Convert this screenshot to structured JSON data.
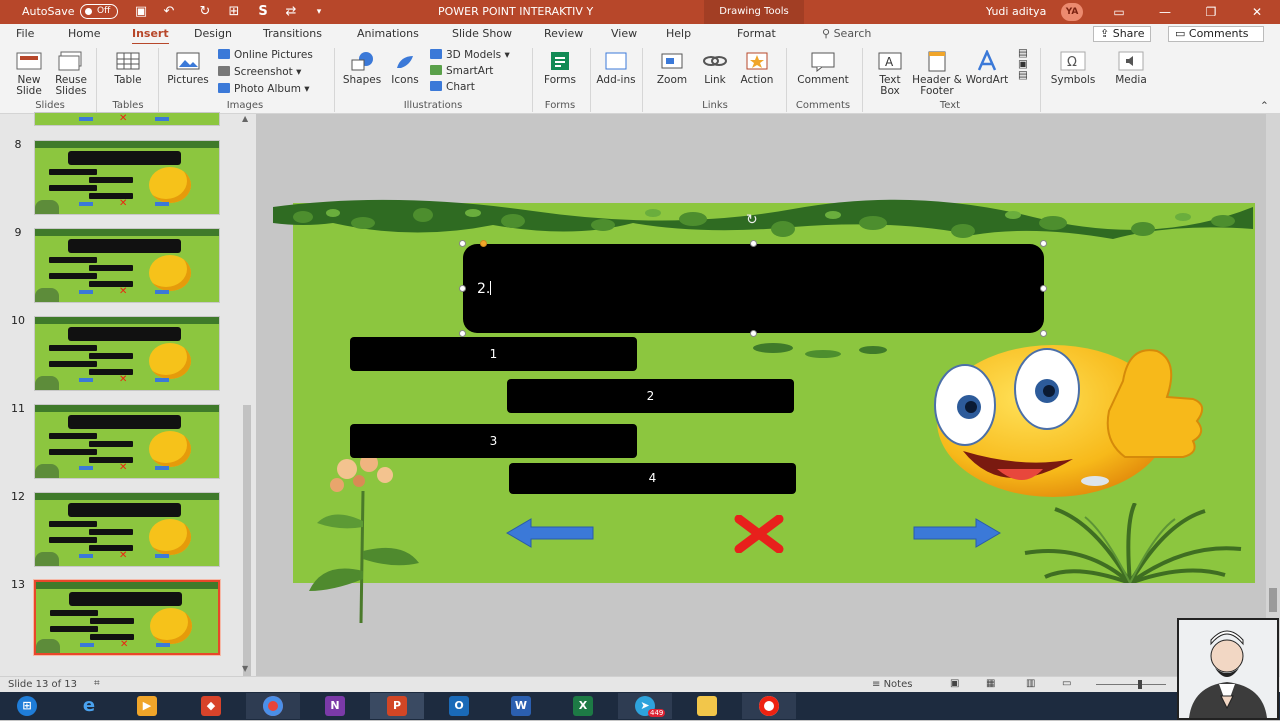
{
  "titlebar": {
    "autosave_label": "AutoSave",
    "autosave_state": "Off",
    "document_title": "POWER POINT INTERAKTIV Y",
    "contextual_tab_group": "Drawing Tools",
    "user_name": "Yudi aditya",
    "user_initials": "YA"
  },
  "tabs": [
    "File",
    "Home",
    "Insert",
    "Design",
    "Transitions",
    "Animations",
    "Slide Show",
    "Review",
    "View",
    "Help",
    "Format"
  ],
  "active_tab": "Insert",
  "search_placeholder": "Search",
  "share_label": "Share",
  "comments_label": "Comments",
  "ribbon": {
    "slides": {
      "new_slide": "New Slide",
      "reuse_slides": "Reuse Slides",
      "group": "Slides"
    },
    "tables": {
      "table": "Table",
      "group": "Tables"
    },
    "images": {
      "pictures": "Pictures",
      "online_pictures": "Online Pictures",
      "screenshot": "Screenshot",
      "photo_album": "Photo Album",
      "group": "Images"
    },
    "illustrations": {
      "shapes": "Shapes",
      "icons": "Icons",
      "models": "3D Models",
      "smartart": "SmartArt",
      "chart": "Chart",
      "group": "Illustrations"
    },
    "forms": {
      "forms": "Forms",
      "group": "Forms"
    },
    "addins": {
      "addins": "Add-ins"
    },
    "links": {
      "zoom": "Zoom",
      "link": "Link",
      "action": "Action",
      "group": "Links"
    },
    "comments": {
      "comment": "Comment",
      "group": "Comments"
    },
    "text": {
      "textbox": "Text Box",
      "header_footer": "Header & Footer",
      "wordart": "WordArt",
      "group": "Text"
    },
    "symbols": {
      "symbols": "Symbols"
    },
    "media": {
      "media": "Media"
    }
  },
  "thumbnails": [
    {
      "number": "8"
    },
    {
      "number": "9"
    },
    {
      "number": "10"
    },
    {
      "number": "11"
    },
    {
      "number": "12"
    },
    {
      "number": "13",
      "selected": true
    }
  ],
  "slide": {
    "question_text": "2.",
    "options": [
      "1",
      "2",
      "3",
      "4"
    ]
  },
  "status": {
    "slide_indicator": "Slide 13 of 13",
    "notes_label": "Notes"
  },
  "taskbar": {
    "telegram_badge": "449"
  },
  "colors": {
    "accent": "#b7472a",
    "slide_bg": "#8cc63f",
    "arrow_blue": "#3b79d8",
    "x_red": "#e8201c"
  }
}
